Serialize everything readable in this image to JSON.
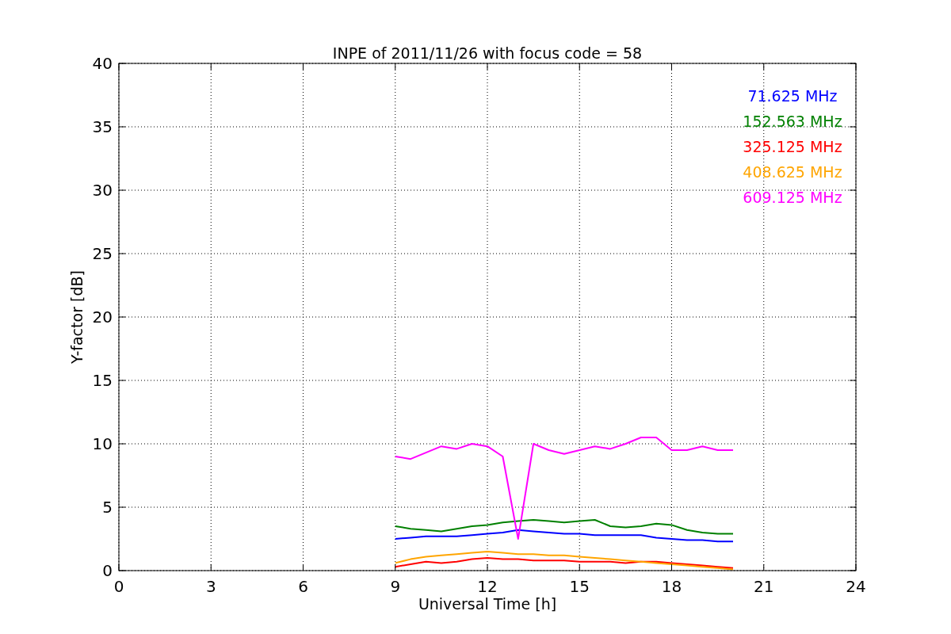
{
  "figure": {
    "chart_data": {
      "type": "line",
      "title": "INPE of 2011/11/26 with focus code = 58",
      "xlabel": "Universal Time [h]",
      "ylabel": "Y-factor [dB]",
      "x": [
        9,
        9.5,
        10,
        10.5,
        11,
        11.5,
        12,
        12.5,
        13,
        13.5,
        14,
        14.5,
        15,
        15.5,
        16,
        16.5,
        17,
        17.5,
        18,
        18.5,
        19,
        19.5,
        20
      ],
      "series": [
        {
          "name": "71.625 MHz",
          "color": "#0000ff",
          "values": [
            2.5,
            2.6,
            2.7,
            2.7,
            2.7,
            2.8,
            2.9,
            3.0,
            3.2,
            3.1,
            3.0,
            2.9,
            2.9,
            2.8,
            2.8,
            2.8,
            2.8,
            2.6,
            2.5,
            2.4,
            2.4,
            2.3,
            2.3
          ]
        },
        {
          "name": "152.563 MHz",
          "color": "#008000",
          "values": [
            3.5,
            3.3,
            3.2,
            3.1,
            3.3,
            3.5,
            3.6,
            3.8,
            3.9,
            4.0,
            3.9,
            3.8,
            3.9,
            4.0,
            3.5,
            3.4,
            3.5,
            3.7,
            3.6,
            3.2,
            3.0,
            2.9,
            2.9
          ]
        },
        {
          "name": "325.125 MHz",
          "color": "#ff0000",
          "values": [
            0.3,
            0.5,
            0.7,
            0.6,
            0.7,
            0.9,
            1.0,
            0.9,
            0.9,
            0.8,
            0.8,
            0.8,
            0.7,
            0.7,
            0.7,
            0.6,
            0.7,
            0.7,
            0.6,
            0.5,
            0.4,
            0.3,
            0.2
          ]
        },
        {
          "name": "408.625 MHz",
          "color": "#ffa500",
          "values": [
            0.6,
            0.9,
            1.1,
            1.2,
            1.3,
            1.4,
            1.5,
            1.4,
            1.3,
            1.3,
            1.2,
            1.2,
            1.1,
            1.0,
            0.9,
            0.8,
            0.7,
            0.6,
            0.5,
            0.4,
            0.3,
            0.2,
            0.1
          ]
        },
        {
          "name": "609.125 MHz",
          "color": "#ff00ff",
          "values": [
            9.0,
            8.8,
            9.3,
            9.8,
            9.6,
            10.0,
            9.8,
            9.0,
            2.5,
            10.0,
            9.5,
            9.2,
            9.5,
            9.8,
            9.6,
            10.0,
            10.5,
            10.5,
            9.5,
            9.5,
            9.8,
            9.5,
            9.5
          ]
        }
      ],
      "grid": true,
      "xlim": [
        0,
        24
      ],
      "ylim": [
        0,
        40
      ],
      "xticks": [
        0,
        3,
        6,
        9,
        12,
        15,
        18,
        21,
        24
      ],
      "yticks": [
        0,
        5,
        10,
        15,
        20,
        25,
        30,
        35,
        40
      ]
    }
  }
}
